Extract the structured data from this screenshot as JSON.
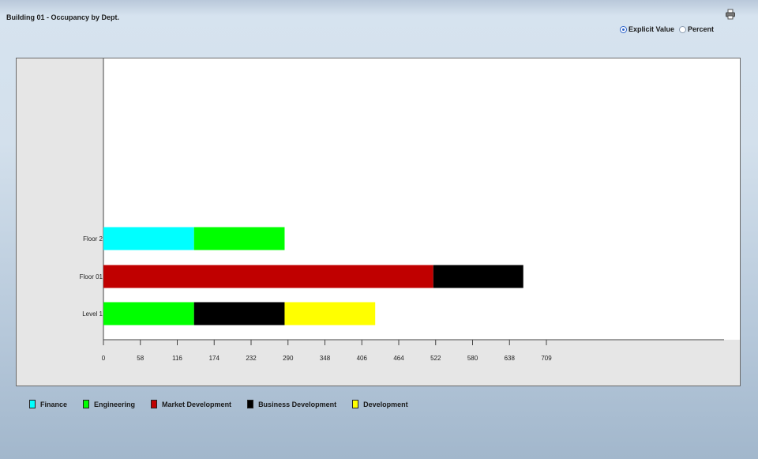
{
  "header": {
    "title": "Building 01 - Occupancy by Dept.",
    "print_icon": "printer-icon"
  },
  "display_mode": {
    "options": [
      {
        "label": "Explicit Value",
        "checked": true
      },
      {
        "label": "Percent",
        "checked": false
      }
    ]
  },
  "chart_data": {
    "type": "bar",
    "orientation": "horizontal",
    "stacked": true,
    "categories": [
      "Floor 2",
      "Floor 01",
      "Level 1"
    ],
    "series": [
      {
        "name": "Finance",
        "color": "#00ffff",
        "values": [
          145,
          0,
          0
        ]
      },
      {
        "name": "Engineering",
        "color": "#00ff00",
        "values": [
          145,
          0,
          145
        ]
      },
      {
        "name": "Market Development",
        "color": "#c00000",
        "values": [
          0,
          528,
          0
        ]
      },
      {
        "name": "Business Development",
        "color": "#000000",
        "values": [
          0,
          144,
          145
        ]
      },
      {
        "name": "Development",
        "color": "#ffff00",
        "values": [
          0,
          0,
          145
        ]
      }
    ],
    "x_ticks": [
      "0",
      "58",
      "116",
      "174",
      "232",
      "290",
      "348",
      "406",
      "464",
      "522",
      "580",
      "638",
      "709"
    ],
    "xlim": [
      0,
      709
    ],
    "legend_position": "bottom"
  }
}
